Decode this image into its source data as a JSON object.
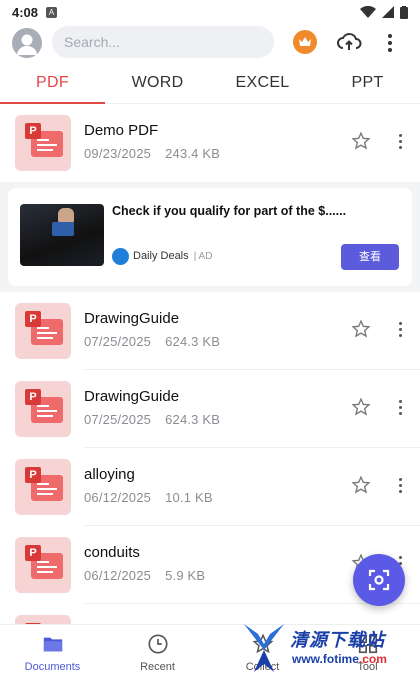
{
  "status_bar": {
    "time": "4:08",
    "a_badge": "A"
  },
  "top_bar": {
    "search_placeholder": "Search...",
    "icons": [
      "avatar-icon",
      "crown-icon",
      "cloud-upload-icon",
      "more-vert-icon"
    ]
  },
  "tabs": [
    {
      "label": "PDF",
      "active": true
    },
    {
      "label": "WORD",
      "active": false
    },
    {
      "label": "EXCEL",
      "active": false
    },
    {
      "label": "PPT",
      "active": false
    }
  ],
  "files": [
    {
      "name": "Demo PDF",
      "date": "09/23/2025",
      "size": "243.4 KB"
    },
    {
      "name": "DrawingGuide",
      "date": "07/25/2025",
      "size": "624.3 KB"
    },
    {
      "name": "DrawingGuide",
      "date": "07/25/2025",
      "size": "624.3 KB"
    },
    {
      "name": "alloying",
      "date": "06/12/2025",
      "size": "10.1 KB"
    },
    {
      "name": "conduits",
      "date": "06/12/2025",
      "size": "5.9 KB"
    },
    {
      "name": "",
      "date": "",
      "size": ""
    }
  ],
  "ad": {
    "title": "Check if you qualify for part of the $......",
    "brand": "Daily Deals",
    "tag": "| AD",
    "cta": "查看"
  },
  "bottom_nav": [
    {
      "label": "Documents",
      "icon": "folder-icon",
      "active": true
    },
    {
      "label": "Recent",
      "icon": "clock-icon",
      "active": false
    },
    {
      "label": "Collect",
      "icon": "star-icon",
      "active": false
    },
    {
      "label": "Tool",
      "icon": "grid-icon",
      "active": false
    }
  ],
  "watermark": {
    "name": "清源下载站",
    "url_main": "www.fotime",
    "url_accent": ".com"
  },
  "colors": {
    "accent": "#e04848",
    "primary": "#5a5ae6",
    "pdf_red": "#d83a3a"
  }
}
